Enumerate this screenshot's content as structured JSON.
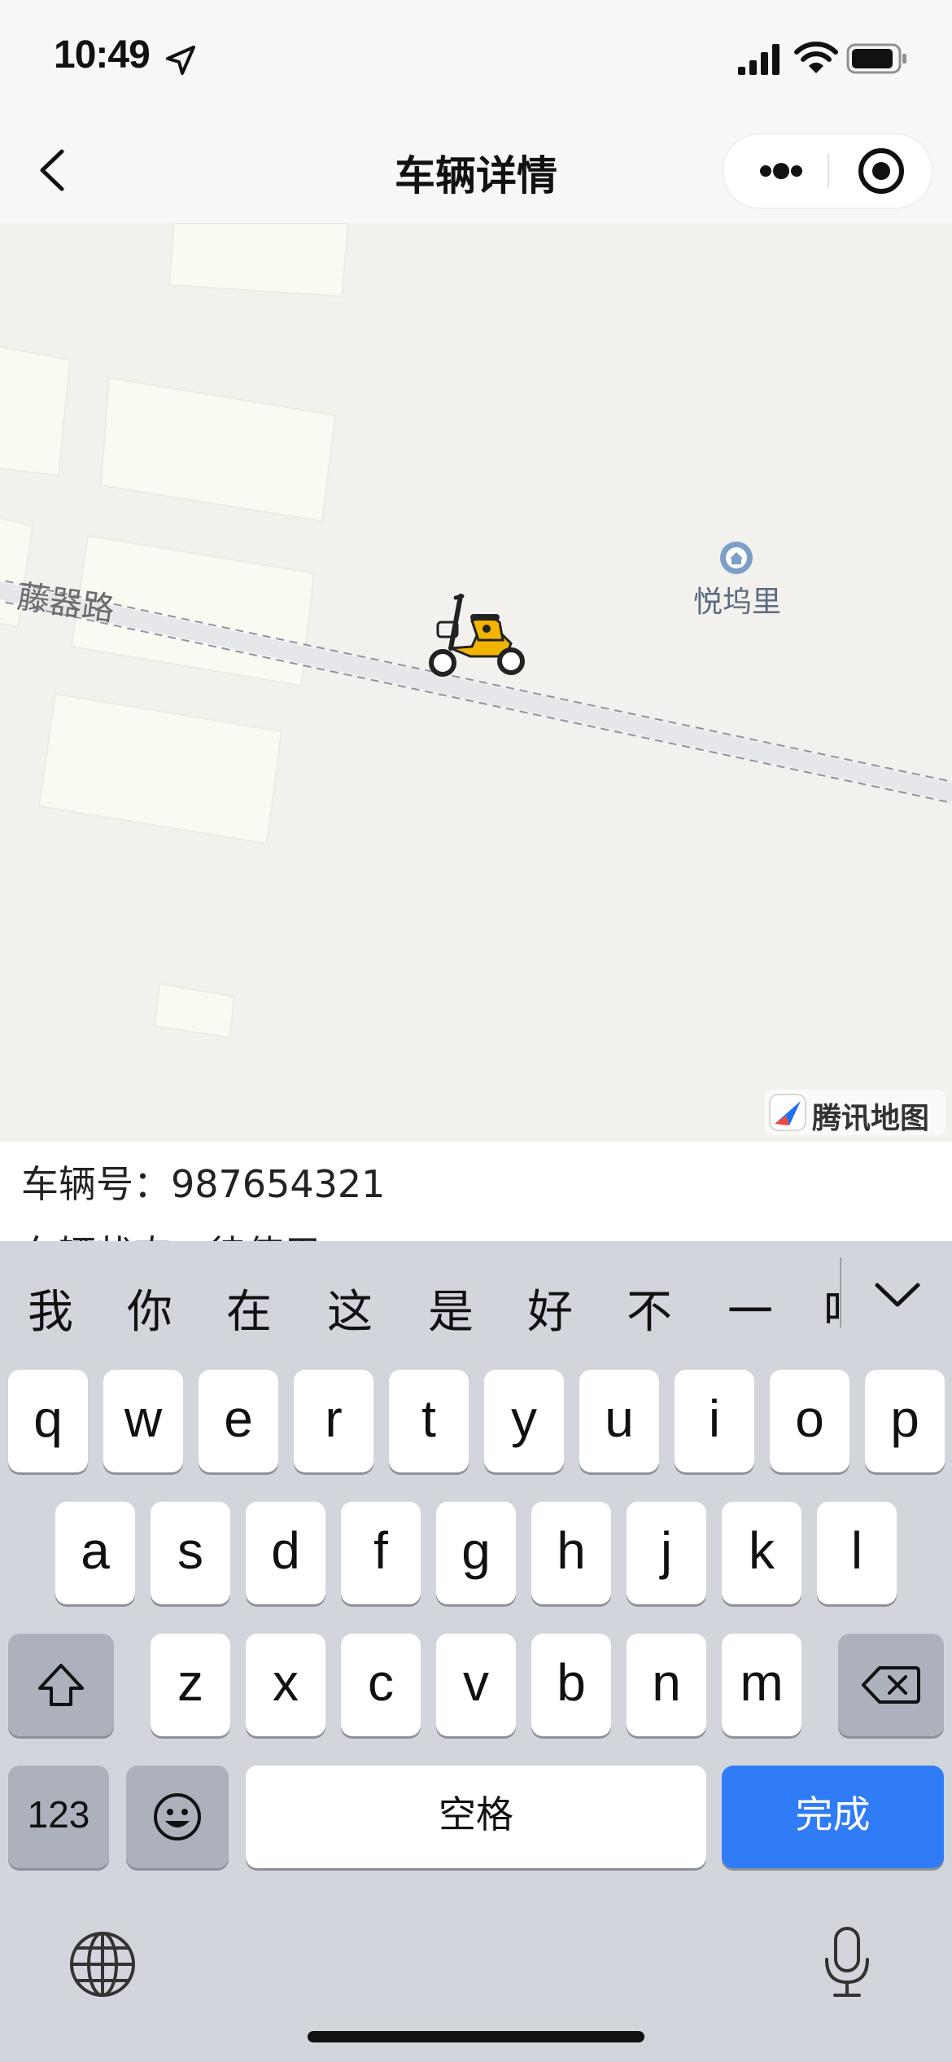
{
  "status_bar": {
    "time": "10:49"
  },
  "nav": {
    "title": "车辆详情"
  },
  "map": {
    "road_label": "藤器路",
    "poi_label": "悦坞里",
    "provider": "腾讯地图"
  },
  "info": {
    "rows": [
      {
        "label": "车辆号",
        "value": "987654321"
      },
      {
        "label": "车辆状态",
        "value": "待使用"
      }
    ]
  },
  "keyboard": {
    "candidates": [
      "我",
      "你",
      "在",
      "这",
      "是",
      "好",
      "不",
      "一",
      "吗"
    ],
    "row1": [
      "q",
      "w",
      "e",
      "r",
      "t",
      "y",
      "u",
      "i",
      "o",
      "p"
    ],
    "row2": [
      "a",
      "s",
      "d",
      "f",
      "g",
      "h",
      "j",
      "k",
      "l"
    ],
    "row3": [
      "z",
      "x",
      "c",
      "v",
      "b",
      "n",
      "m"
    ],
    "numbers_label": "123",
    "space_label": "空格",
    "done_label": "完成"
  },
  "colors": {
    "accent": "#2f7cf6",
    "map_background": "#f2f1ed",
    "keyboard_background": "#d2d5dc"
  }
}
